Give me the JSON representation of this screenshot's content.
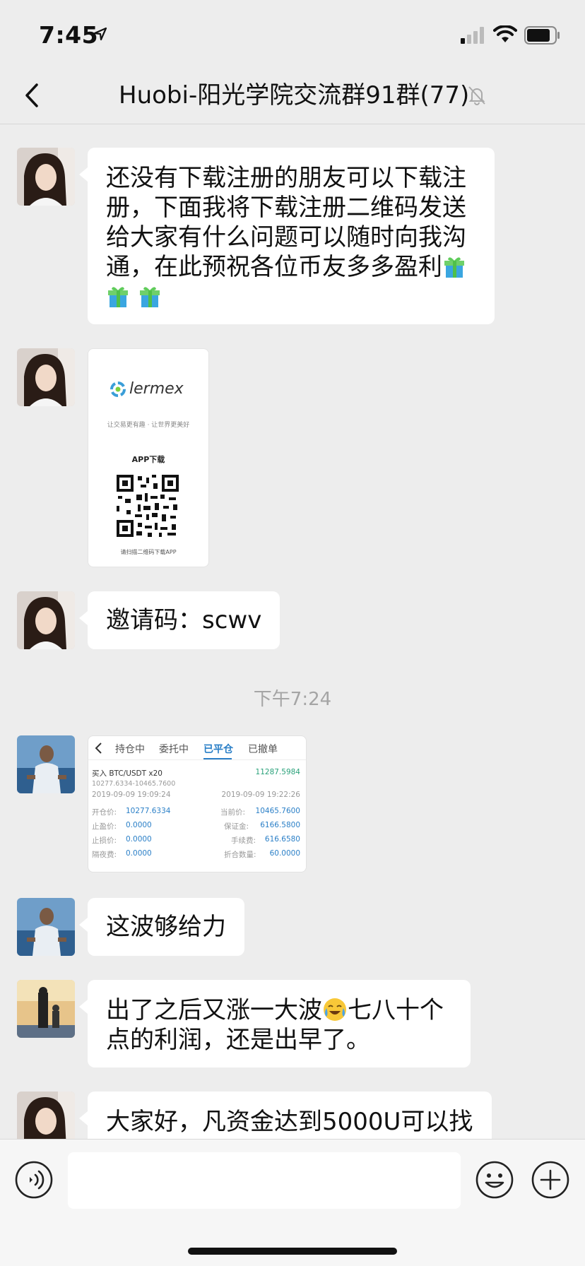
{
  "status": {
    "time": "7:45"
  },
  "header": {
    "title": "Huobi-阳光学院交流群91群(77)"
  },
  "messages": {
    "m1": {
      "text": "还没有下载注册的朋友可以下载注册，下面我将下载注册二维码发送给大家有什么问题可以随时向我沟通，在此预祝各位币友多多盈利"
    },
    "qr": {
      "brand": "lermex",
      "slogan": "让交易更有趣 · 让世界更美好",
      "app_label": "APP下载",
      "footer": "请扫描二维码下载APP"
    },
    "m3": {
      "text": "邀请码：scwv"
    },
    "timestamp": "下午7:24",
    "trade": {
      "tabs": [
        "持仓中",
        "委托中",
        "已平仓",
        "已撤单"
      ],
      "pair": "买入 BTC/USDT x20",
      "profit": "11287.5984",
      "range": "10277.6334-10465.7600",
      "open_time": "2019-09-09 19:09:24",
      "close_time": "2019-09-09 19:22:26",
      "open_price_label": "开仓价:",
      "open_price": "10277.6334",
      "current_price_label": "当前价:",
      "current_price": "10465.7600",
      "take_profit_label": "止盈价:",
      "take_profit": "0.0000",
      "margin_label": "保证金:",
      "margin": "6166.5800",
      "stop_loss_label": "止损价:",
      "stop_loss": "0.0000",
      "fee_label": "手续费:",
      "fee": "616.6580",
      "overnight_label": "隔夜费:",
      "overnight": "0.0000",
      "qty_label": "折合数量:",
      "qty": "60.0000"
    },
    "m5": {
      "text": "这波够给力"
    },
    "m6": {
      "text": "出了之后又涨一大波",
      "text2": "七八十个点的利润，还是出早了。"
    },
    "m7": {
      "text": "大家好，凡资金达到5000U可以找"
    }
  },
  "input": {
    "placeholder": ""
  },
  "colors": {
    "background": "#ededed",
    "bubble": "#ffffff",
    "accent": "#2a7fc7"
  },
  "icons": [
    "location-arrow-icon",
    "signal-icon",
    "wifi-icon",
    "battery-icon",
    "back-chevron-icon",
    "mute-bell-icon",
    "gift-icon",
    "crying-laugh-emoji-icon",
    "voice-icon",
    "emoji-icon",
    "plus-icon"
  ]
}
